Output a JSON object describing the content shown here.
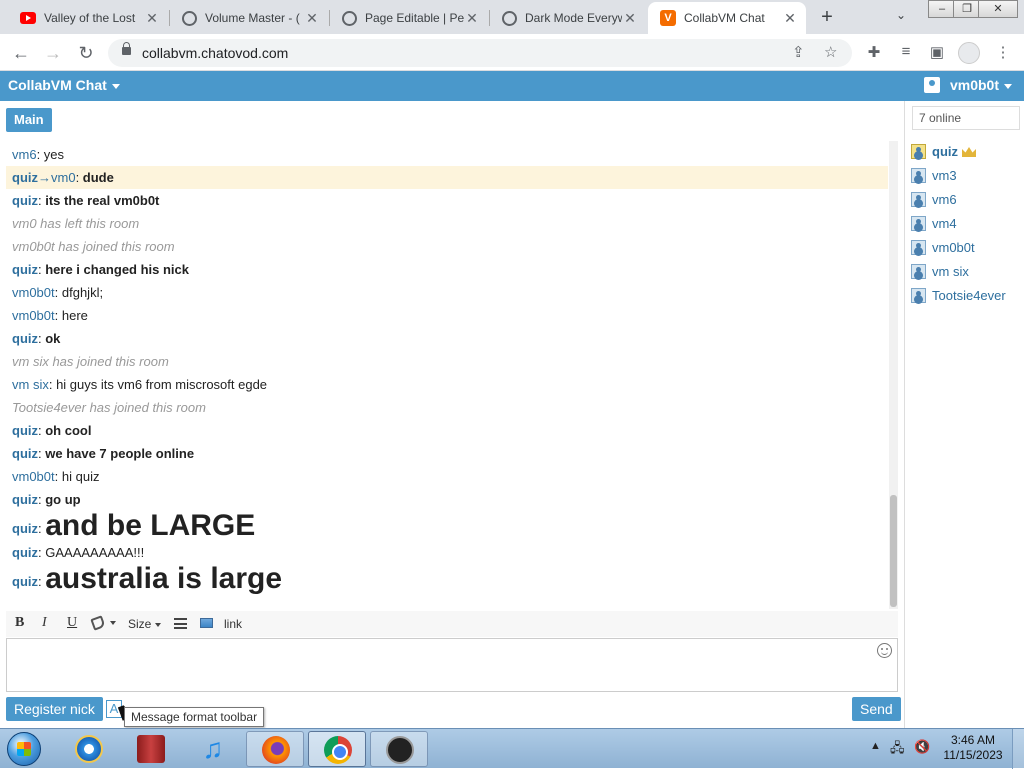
{
  "browser": {
    "tabs": [
      {
        "title": "Valley of the Lost",
        "icon": "youtube-icon",
        "active": false
      },
      {
        "title": "Volume Master - (",
        "icon": "globe-icon",
        "active": false
      },
      {
        "title": "Page Editable | Pe",
        "icon": "globe-icon",
        "active": false
      },
      {
        "title": "Dark Mode Everyw",
        "icon": "globe-icon",
        "active": false
      },
      {
        "title": "CollabVM Chat",
        "icon": "v-icon",
        "active": true
      }
    ],
    "url": "collabvm.chatovod.com",
    "new_tab": "+"
  },
  "app": {
    "brand": "CollabVM Chat",
    "username": "vm0b0t",
    "room_tab": "Main",
    "accent": "#4a98cb"
  },
  "messages": [
    {
      "nick": "vm6",
      "text": "yes",
      "nick_bold": false,
      "text_bold": false
    },
    {
      "nick": "quiz",
      "to": "vm0",
      "text": "dude",
      "nick_bold": true,
      "text_bold": true,
      "highlight": true
    },
    {
      "nick": "quiz",
      "text": "its the real vm0b0t",
      "nick_bold": true,
      "text_bold": true
    },
    {
      "system": true,
      "text": "vm0 has left this room"
    },
    {
      "system": true,
      "text": "vm0b0t has joined this room"
    },
    {
      "nick": "quiz",
      "text": "here i changed his nick",
      "nick_bold": true,
      "text_bold": true
    },
    {
      "nick": "vm0b0t",
      "text": "dfghjkl;",
      "nick_bold": false,
      "text_bold": false
    },
    {
      "nick": "vm0b0t",
      "text": "here",
      "nick_bold": false,
      "text_bold": false
    },
    {
      "nick": "quiz",
      "text": "ok",
      "nick_bold": true,
      "text_bold": true
    },
    {
      "system": true,
      "text": "vm six has joined this room"
    },
    {
      "nick": "vm six",
      "text": "hi guys its vm6 from miscrosoft egde",
      "nick_bold": false,
      "text_bold": false
    },
    {
      "system": true,
      "text": "Tootsie4ever has joined this room"
    },
    {
      "nick": "quiz",
      "text": "oh cool",
      "nick_bold": true,
      "text_bold": true
    },
    {
      "nick": "quiz",
      "text": "we have 7 people online",
      "nick_bold": true,
      "text_bold": true
    },
    {
      "nick": "vm0b0t",
      "text": "hi quiz",
      "nick_bold": false,
      "text_bold": false
    },
    {
      "nick": "quiz",
      "text": "go up",
      "nick_bold": true,
      "text_bold": true
    },
    {
      "nick": "quiz",
      "text": "and be LARGE",
      "nick_bold": true,
      "large": true
    },
    {
      "nick": "quiz",
      "text": "GAAAAAAAAA!!!",
      "nick_bold": true,
      "text_bold": false
    },
    {
      "nick": "quiz",
      "text": "australia is large",
      "nick_bold": true,
      "large": true
    }
  ],
  "format_toolbar": {
    "bold": "B",
    "italic": "I",
    "underline": "U",
    "size": "Size",
    "link": "link"
  },
  "compose": {
    "register_nick": "Register nick",
    "format_toggle": "A",
    "tooltip": "Message format toolbar",
    "send": "Send"
  },
  "sidebar": {
    "online_count": "7 online",
    "users": [
      {
        "name": "quiz",
        "owner": true
      },
      {
        "name": "vm3"
      },
      {
        "name": "vm6"
      },
      {
        "name": "vm4"
      },
      {
        "name": "vm0b0t"
      },
      {
        "name": "vm six"
      },
      {
        "name": "Tootsie4ever"
      }
    ]
  },
  "taskbar": {
    "time": "3:46 AM",
    "date": "11/15/2023"
  }
}
